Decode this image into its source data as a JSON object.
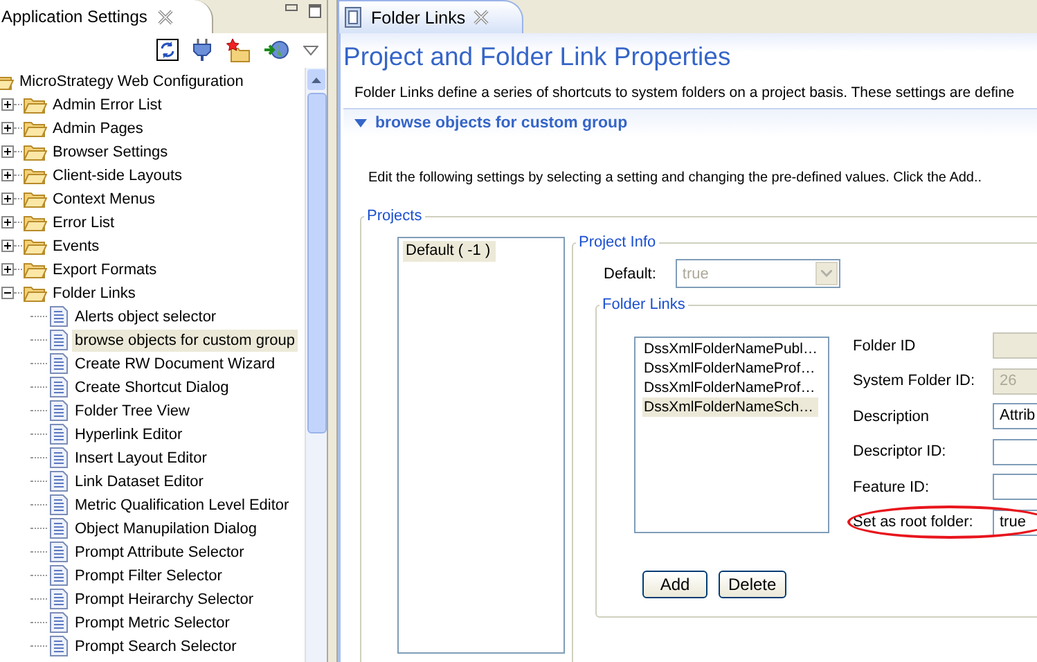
{
  "settings_panel": {
    "title": "Application Settings",
    "tree": {
      "label": "MicroStrategy Web Configuration",
      "kind": "folder",
      "selected": false,
      "children": [
        {
          "label": "Admin Error List",
          "kind": "folder",
          "expanded": false,
          "selected": false
        },
        {
          "label": "Admin Pages",
          "kind": "folder",
          "expanded": false,
          "selected": false
        },
        {
          "label": "Browser Settings",
          "kind": "folder",
          "expanded": false,
          "selected": false
        },
        {
          "label": "Client-side Layouts",
          "kind": "folder",
          "expanded": false,
          "selected": false
        },
        {
          "label": "Context Menus",
          "kind": "folder",
          "expanded": false,
          "selected": false
        },
        {
          "label": "Error List",
          "kind": "folder",
          "expanded": false,
          "selected": false
        },
        {
          "label": "Events",
          "kind": "folder",
          "expanded": false,
          "selected": false
        },
        {
          "label": "Export Formats",
          "kind": "folder",
          "expanded": false,
          "selected": false
        },
        {
          "label": "Folder Links",
          "kind": "folder",
          "expanded": true,
          "selected": false,
          "children": [
            {
              "label": "Alerts object selector",
              "kind": "document",
              "selected": false
            },
            {
              "label": "browse objects for custom group",
              "kind": "document",
              "selected": true
            },
            {
              "label": "Create RW Document Wizard",
              "kind": "document",
              "selected": false
            },
            {
              "label": "Create Shortcut Dialog",
              "kind": "document",
              "selected": false
            },
            {
              "label": "Folder Tree View",
              "kind": "document",
              "selected": false
            },
            {
              "label": "Hyperlink Editor",
              "kind": "document",
              "selected": false
            },
            {
              "label": "Insert Layout Editor",
              "kind": "document",
              "selected": false
            },
            {
              "label": "Link Dataset Editor",
              "kind": "document",
              "selected": false
            },
            {
              "label": "Metric Qualification Level Editor",
              "kind": "document",
              "selected": false
            },
            {
              "label": "Object Manupilation Dialog",
              "kind": "document",
              "selected": false
            },
            {
              "label": "Prompt Attribute Selector",
              "kind": "document",
              "selected": false
            },
            {
              "label": "Prompt Filter Selector",
              "kind": "document",
              "selected": false
            },
            {
              "label": "Prompt Heirarchy Selector",
              "kind": "document",
              "selected": false
            },
            {
              "label": "Prompt Metric Selector",
              "kind": "document",
              "selected": false
            },
            {
              "label": "Prompt Search Selector",
              "kind": "document",
              "selected": false
            }
          ]
        }
      ]
    }
  },
  "editor": {
    "tab": "Folder Links",
    "title": "Project and Folder Link Properties",
    "description": "Folder Links define a series of shortcuts to system folders on a project basis. These settings are define",
    "section": {
      "title": "browse objects for custom group",
      "expanded": true,
      "instructions": "Edit the following settings by selecting a setting and changing the pre-defined values. Click the Add..",
      "projects": {
        "legend": "Projects",
        "items": [
          {
            "label": "Default ( -1 )",
            "selected": true
          }
        ]
      },
      "project_info": {
        "legend": "Project Info",
        "default_label": "Default:",
        "default_value": "true",
        "default_disabled": true
      },
      "folder_links": {
        "legend": "Folder Links",
        "items": [
          {
            "label": "DssXmlFolderNamePubl…",
            "selected": false
          },
          {
            "label": "DssXmlFolderNameProf…",
            "selected": false
          },
          {
            "label": "DssXmlFolderNameProf…",
            "selected": false
          },
          {
            "label": "DssXmlFolderNameSch…",
            "selected": true
          }
        ],
        "fields": [
          {
            "label": "Folder ID",
            "disabled": true,
            "highlighted": false
          },
          {
            "label": "System Folder ID:",
            "value": "26",
            "disabled": true,
            "highlighted": false
          },
          {
            "label": "Description",
            "value": "Attrib",
            "disabled": false,
            "highlighted": false
          },
          {
            "label": "Descriptor ID:",
            "disabled": false,
            "highlighted": false
          },
          {
            "label": "Feature ID:",
            "disabled": false,
            "highlighted": false
          },
          {
            "label": "Set as root folder:",
            "value": "true",
            "disabled": false,
            "highlighted": true
          }
        ],
        "buttons": [
          "Add",
          "Delete"
        ]
      }
    }
  }
}
